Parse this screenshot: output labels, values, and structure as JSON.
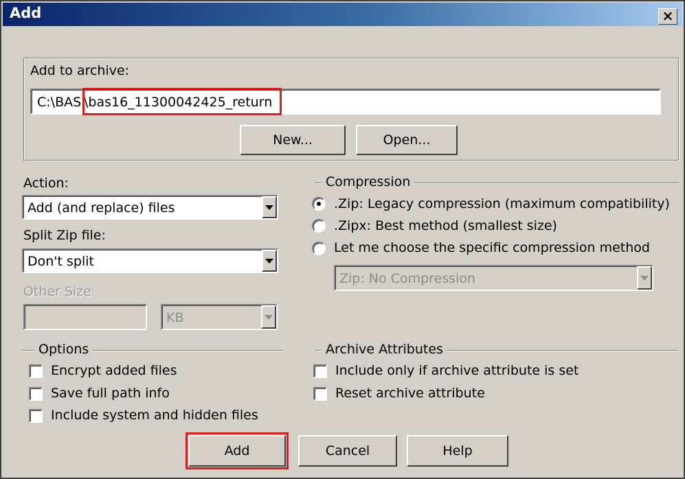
{
  "dialog": {
    "title": "Add",
    "close_glyph": "×"
  },
  "archive": {
    "label": "Add to archive:",
    "path_prefix": "C:\\BAS",
    "path_rest": "\\bas16_11300042425_return",
    "new_button": "New...",
    "open_button": "Open..."
  },
  "action": {
    "label": "Action:",
    "value": "Add (and replace) files"
  },
  "split": {
    "label": "Split Zip file:",
    "value": "Don't split"
  },
  "other_size": {
    "label": "Other Size",
    "value": "",
    "unit": "KB"
  },
  "compression": {
    "title": "Compression",
    "options": [
      {
        "label": ".Zip: Legacy compression (maximum compatibility)",
        "selected": true
      },
      {
        "label": ".Zipx: Best method (smallest size)",
        "selected": false
      },
      {
        "label": "Let me choose the specific compression method",
        "selected": false
      }
    ],
    "method_value": "Zip: No Compression"
  },
  "options": {
    "title": "Options",
    "items": [
      {
        "label": "Encrypt added files",
        "checked": false
      },
      {
        "label": "Save full path info",
        "checked": false
      },
      {
        "label": "Include system and hidden files",
        "checked": false
      }
    ]
  },
  "attributes": {
    "title": "Archive Attributes",
    "items": [
      {
        "label": "Include only if archive attribute is set",
        "checked": false
      },
      {
        "label": "Reset archive attribute",
        "checked": false
      }
    ]
  },
  "buttons": {
    "add": "Add",
    "cancel": "Cancel",
    "help": "Help"
  },
  "colors": {
    "highlight": "#e01b1b",
    "title_bar": "#0a246a",
    "dialog_bg": "#d4d0c8"
  }
}
